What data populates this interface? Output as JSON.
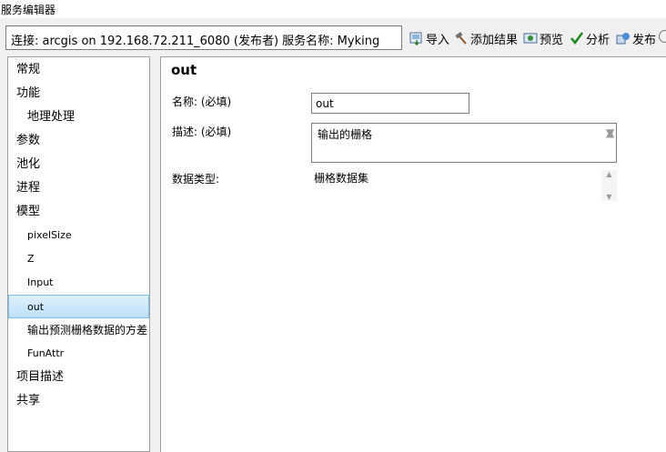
{
  "window": {
    "title": "服务编辑器"
  },
  "connection": {
    "text": "连接: arcgis on 192.168.72.211_6080 (发布者)    服务名称: Myking"
  },
  "toolbar": {
    "import": "导入",
    "add_result": "添加结果",
    "preview": "预览",
    "analyze": "分析",
    "publish": "发布"
  },
  "sidebar": {
    "items": [
      {
        "label": "常规"
      },
      {
        "label": "功能"
      },
      {
        "label": "地理处理"
      },
      {
        "label": "参数"
      },
      {
        "label": "池化"
      },
      {
        "label": "进程"
      },
      {
        "label": "模型"
      },
      {
        "label": "pixelSize"
      },
      {
        "label": "Z"
      },
      {
        "label": "Input"
      },
      {
        "label": "out"
      },
      {
        "label": "输出预测栅格数据的方差"
      },
      {
        "label": "FunAttr"
      },
      {
        "label": "项目描述"
      },
      {
        "label": "共享"
      }
    ]
  },
  "main": {
    "title": "out",
    "name_label": "名称: (必填)",
    "name_value": "out",
    "desc_label": "描述: (必填)",
    "desc_value": "输出的栅格",
    "type_label": "数据类型:",
    "type_value": "栅格数据集"
  }
}
